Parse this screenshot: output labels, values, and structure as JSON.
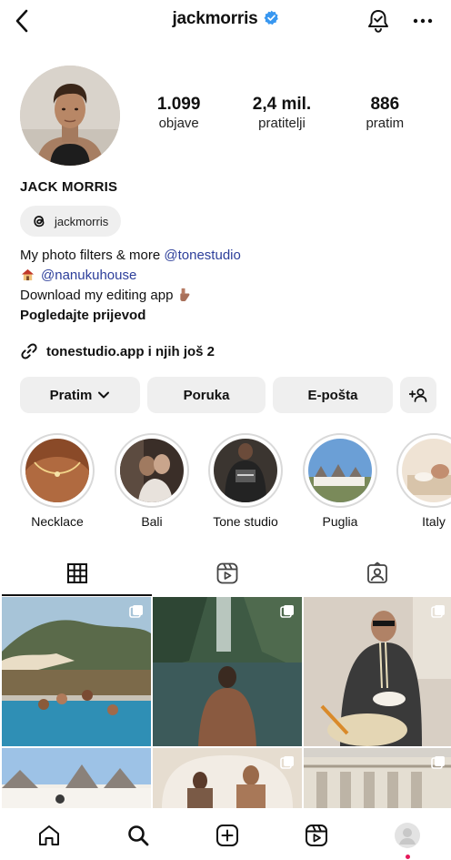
{
  "header": {
    "username": "jackmorris",
    "back_icon": "chevron-left-icon",
    "verified_icon": "verified-badge-icon",
    "notifications_icon": "bell-icon",
    "more_icon": "more-dots-icon",
    "more_label": "···"
  },
  "profile": {
    "stats": [
      {
        "value": "1.099",
        "label": "objave"
      },
      {
        "value": "2,4 mil.",
        "label": "pratitelji"
      },
      {
        "value": "886",
        "label": "pratim"
      }
    ],
    "full_name": "JACK MORRIS",
    "threads_handle": "jackmorris",
    "bio": {
      "line1_text": "My photo filters & more ",
      "line1_mention": "@tonestudio",
      "line2_mention": "@nanukuhouse",
      "line3_text": "Download my editing app",
      "line4_text": "Pogledajte prijevod"
    },
    "link_text": "tonestudio.app i njih još 2"
  },
  "actions": {
    "follow_label": "Pratim",
    "message_label": "Poruka",
    "email_label": "E-pošta"
  },
  "highlights": [
    {
      "label": "Necklace"
    },
    {
      "label": "Bali"
    },
    {
      "label": "Tone studio"
    },
    {
      "label": "Puglia"
    },
    {
      "label": "Italy"
    }
  ],
  "tabs": [
    "grid-icon",
    "reels-icon",
    "tagged-icon"
  ],
  "bottom_nav": [
    "home-icon",
    "search-icon",
    "create-icon",
    "reels-icon",
    "profile-avatar"
  ],
  "colors": {
    "accent_link": "#2c3e9a",
    "verified": "#3897f0",
    "button_bg": "#efefef",
    "notification_dot": "#e5195a"
  }
}
